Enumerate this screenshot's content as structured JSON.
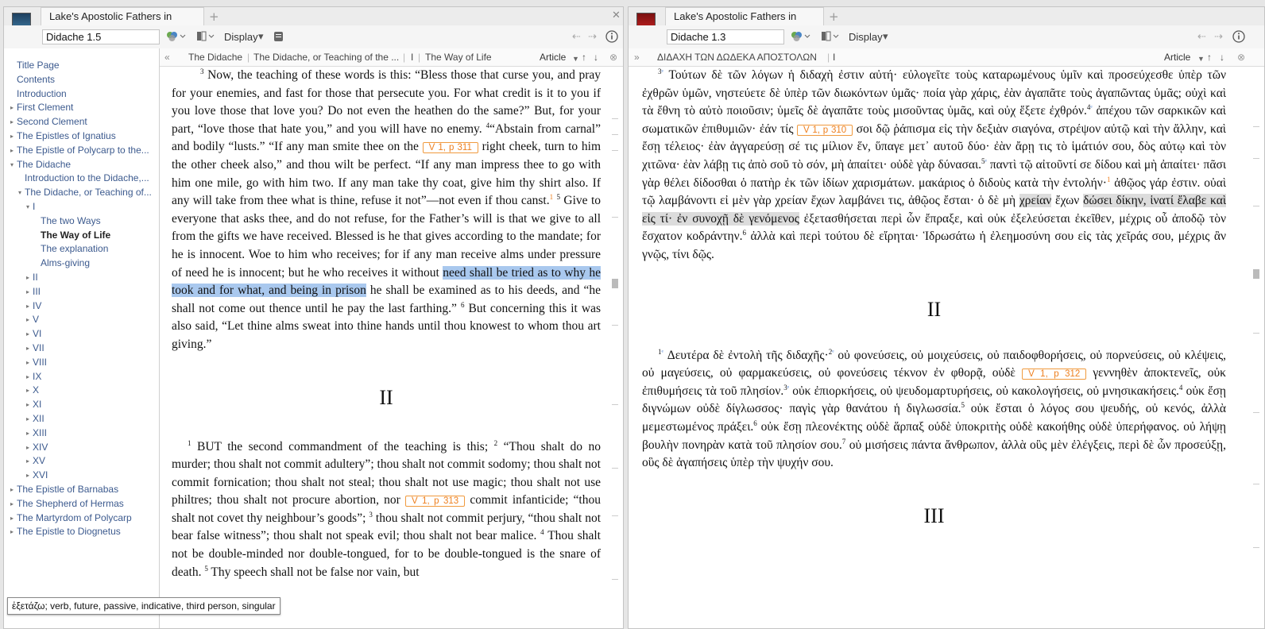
{
  "left_pane": {
    "tab_title": "Lake's Apostolic Fathers in English",
    "book_badge": "A",
    "reference": "Didache 1.5",
    "display_label": "Display",
    "breadcrumb": [
      "The Didache",
      "The Didache, or Teaching of the ...",
      "I",
      "The Way of Life"
    ],
    "view_label": "Article",
    "toc": [
      {
        "label": "Title Page",
        "level": 0,
        "toggle": ""
      },
      {
        "label": "Contents",
        "level": 0,
        "toggle": ""
      },
      {
        "label": "Introduction",
        "level": 0,
        "toggle": ""
      },
      {
        "label": "First Clement",
        "level": 0,
        "toggle": "▸"
      },
      {
        "label": "Second Clement",
        "level": 0,
        "toggle": "▸"
      },
      {
        "label": "The Epistles of Ignatius",
        "level": 0,
        "toggle": "▸"
      },
      {
        "label": "The Epistle of Polycarp to the...",
        "level": 0,
        "toggle": "▸"
      },
      {
        "label": "The Didache",
        "level": 0,
        "toggle": "▾"
      },
      {
        "label": "Introduction to the Didache,...",
        "level": 1,
        "toggle": ""
      },
      {
        "label": "The Didache, or Teaching of...",
        "level": 1,
        "toggle": "▾"
      },
      {
        "label": "I",
        "level": 2,
        "toggle": "▾"
      },
      {
        "label": "The two Ways",
        "level": 3,
        "toggle": ""
      },
      {
        "label": "The Way of Life",
        "level": 3,
        "toggle": "",
        "selected": true
      },
      {
        "label": "The explanation",
        "level": 3,
        "toggle": ""
      },
      {
        "label": "Alms-giving",
        "level": 3,
        "toggle": ""
      },
      {
        "label": "II",
        "level": 2,
        "toggle": "▸"
      },
      {
        "label": "III",
        "level": 2,
        "toggle": "▸"
      },
      {
        "label": "IV",
        "level": 2,
        "toggle": "▸"
      },
      {
        "label": "V",
        "level": 2,
        "toggle": "▸"
      },
      {
        "label": "VI",
        "level": 2,
        "toggle": "▸"
      },
      {
        "label": "VII",
        "level": 2,
        "toggle": "▸"
      },
      {
        "label": "VIII",
        "level": 2,
        "toggle": "▸"
      },
      {
        "label": "IX",
        "level": 2,
        "toggle": "▸"
      },
      {
        "label": "X",
        "level": 2,
        "toggle": "▸"
      },
      {
        "label": "XI",
        "level": 2,
        "toggle": "▸"
      },
      {
        "label": "XII",
        "level": 2,
        "toggle": "▸"
      },
      {
        "label": "XIII",
        "level": 2,
        "toggle": "▸"
      },
      {
        "label": "XIV",
        "level": 2,
        "toggle": "▸"
      },
      {
        "label": "XV",
        "level": 2,
        "toggle": "▸"
      },
      {
        "label": "XVI",
        "level": 2,
        "toggle": "▸"
      },
      {
        "label": "The Epistle of Barnabas",
        "level": 0,
        "toggle": "▸"
      },
      {
        "label": "The Shepherd of Hermas",
        "level": 0,
        "toggle": "▸"
      },
      {
        "label": "The Martyrdom of Polycarp",
        "level": 0,
        "toggle": "▸"
      },
      {
        "label": "The Epistle to Diognetus",
        "level": 0,
        "toggle": "▸"
      }
    ],
    "text": {
      "v3_num": "3",
      "p1_a": " Now, the teaching of these words is this: “Bless those that curse you, and pray for your enemies, and fast for those that persecute you. For what credit is it to you if you love those that love you? Do not even the heathen do the same?” But, for your part, “love those that hate you,” and you will have no enemy. ",
      "v4_num": "4",
      "p1_b": "“Abstain from carnal” and bodily “lusts.” “If any man smite thee on the ",
      "page_311": "V 1, p 311",
      "p1_c": " right cheek, turn to him the other cheek also,” and thou wilt be perfect. “If any man impress thee to go with him one mile, go with him two. If any man take thy coat, give him thy shirt also. If any will take from thee what is thine, refuse it not”—not even if thou canst.",
      "fn1": "1",
      "v5_num": "5",
      "p1_d": " Give to everyone that asks thee, and do not refuse, for the Father’s will is that we give to all from the gifts we have received. Blessed is he that gives according to the mandate; for he is innocent. Woe to him who receives; for if any man receive alms under pressure of need he is innocent; but he who receives it without ",
      "p1_highlight": "need shall be tried as to why he took and for what, and being in prison",
      "p1_e": " he shall be examined as to his deeds, and “he shall not come out thence until he pay the last farthing.” ",
      "v6_num": "6",
      "p1_f": " But concerning this it was also said, “Let thine alms sweat into thine hands until thou knowest to whom thou art giving.”",
      "section_ii": "II",
      "v1_num": "1",
      "p2_a": " BUT the second commandment of the teaching is this; ",
      "v2_num": "2",
      "p2_b": " “Thou shalt do no murder; thou shalt not commit adultery”; thou shalt not commit sodomy; thou shalt not commit fornication; thou shalt not steal; thou shalt not use magic; thou shalt not use philtres; thou shalt not procure abortion, nor ",
      "page_313": "V 1, p 313",
      "p2_c": " commit infanticide; “thou shalt not covet thy neighbour’s goods”; ",
      "v3b_num": "3",
      "p2_d": " thou shalt not commit perjury, “thou shalt not bear false witness”; thou shalt not speak evil; thou shalt not bear malice. ",
      "v4b_num": "4",
      "p2_e": " Thou shalt not be double-minded nor double-tongued, for to be double-tongued is the snare of death. ",
      "v5b_num": "5",
      "p2_f": " Thy speech shall not be false nor vain, but"
    }
  },
  "right_pane": {
    "tab_title": "Lake's Apostolic Fathers in Greek",
    "book_badge": "A",
    "reference": "Didache 1.3",
    "display_label": "Display",
    "breadcrumb": [
      "ΔΙΔΑΧΗ ΤΩΝ ΔΩΔΕΚΑ ΑΠΟΣΤΟΛΩΝ",
      "I"
    ],
    "view_label": "Article",
    "text": {
      "v3_num": "3",
      "g1_a": " Τούτων δὲ τῶν λόγων ἡ διδαχὴ ἐστιν αὐτή· εὐλογεῖτε τοὺς καταρωμένους ὑμῖν καὶ προσεύχεσθε ὑπὲρ τῶν ἐχθρῶν ὑμῶν, νηστεύετε δὲ ὑπὲρ τῶν διωκόντων ὑμᾶς· ποία γὰρ χάρις, ἐὰν ἀγαπᾶτε τοὺς ἀγαπῶντας ὑμᾶς; οὐχὶ καὶ τὰ ἔθνη τὸ αὐτὸ ποιοῦσιν; ὑμεῖς δὲ ἀγαπᾶτε τοὺς μισοῦντας ὑμᾶς, καὶ οὐχ ἕξετε ἐχθρόν.",
      "v4_num": "4",
      "g1_b": " ἀπέχου τῶν σαρκικῶν καὶ σωματικῶν ἐπιθυμιῶν· ἐάν τίς ",
      "page_310": "V 1, p 310",
      "g1_c": " σοι δῷ ῥάπισμα εἰς τὴν δεξιὰν σιαγόνα, στρέψον αὐτῷ καὶ τὴν ἄλλην, καὶ ἔσῃ τέλειος· ἐὰν ἀγγαρεύσῃ σέ τις μίλιον ἕν, ὕπαγε μετ᾽ αυτοῦ δύο· ἐὰν ἄρῃ τις τὸ ἱμάτιόν σου, δὸς αὐτῳ καὶ τὸν χιτῶνα· ἐὰν λάβῃ τις ἀπὸ σοῦ τὸ σόν, μὴ ἀπαίτει· οὐδὲ γὰρ δύνασαι.",
      "v5_num": "5",
      "g1_d": " παντὶ τῷ αἰτοῦντί σε δίδου καὶ μὴ ἀπαίτει· πᾶσι γὰρ θέλει δίδοσθαι ὁ πατὴρ ἐκ τῶν ἰδίων χαρισμάτων. μακάριος ὁ διδοὺς κατὰ τὴν ἐντολήν·",
      "fn1": "1",
      "g1_e": " ἀθῷος γάρ ἐστιν. οὐαὶ τῷ λαμβάνοντι εἰ μὲν γὰρ χρείαν ἔχων λαμβάνει τις, ἀθῷος ἔσται· ὁ δὲ μὴ ",
      "g1_gray1": "χρείαν",
      "g1_f": " ἔχων ",
      "g1_gray2": "δώσει δίκην, ἱνατί ἔλαβε καὶ εἰς τί· ἐν συνοχῇ δὲ γενόμενος",
      "g1_g": " ἐξετασθήσεται περὶ ὧν ἔπραξε, καὶ οὐκ ἐξελεύσεται ἐκεῖθεν, μέχρις οὗ ἀποδῷ τὸν ἔσχατον κοδράντην.",
      "v6_num": "6",
      "g1_h": " ἀλλὰ καὶ περὶ τούτου δὲ εἴρηται· Ἱδρωσάτω ἡ ἐλεημοσύνη σου εἰς τὰς χεῖράς σου, μέχρις ἂν γνῷς, τίνι δῷς.",
      "section_ii": "II",
      "v1_num": "1",
      "g2_a": " Δευτέρα δὲ ἐντολὴ τῆς διδαχῆς·",
      "v2_num": "2",
      "g2_b": " οὐ φονεύσεις, οὐ μοιχεύσεις, οὐ παιδοφθορήσεις, οὐ πορνεύσεις, οὐ κλέψεις, οὐ μαγεύσεις, οὐ φαρμακεύσεις, οὐ φονεύσεις τέκνον ἐν φθορᾷ, οὐδὲ ",
      "page_312": "V 1, p 312",
      "g2_c": " γεννηθὲν ἀποκτενεῖς, οὐκ ἐπιθυμήσεις τὰ τοῦ πλησίον.",
      "v3b_num": "3",
      "g2_d": " οὐκ ἐπιορκήσεις, οὐ ψευδομαρτυρήσεις, οὐ κακολογήσεις, οὐ μνησικακήσεις.",
      "v4b_num": "4",
      "g2_e": " οὐκ ἔσῃ διγνώμων οὐδὲ δίγλωσσος· παγὶς γὰρ θανάτου ἡ διγλωσσία.",
      "v5b_num": "5",
      "g2_f": " οὐκ ἔσται ὁ λόγος σου ψευδής, οὐ κενός, ἀλλὰ μεμεστωμένος πράξει.",
      "v6b_num": "6",
      "g2_g": " οὐκ ἔσῃ πλεονέκτης οὐδὲ ἅρπαξ οὐδὲ ὑποκριτὴς οὐδὲ κακοήθης οὐδὲ ὑπερήφανος. οὐ λήψῃ βουλὴν πονηρὰν κατὰ τοῦ πλησίον σου.",
      "v7_num": "7",
      "g2_h": " οὐ μισήσεις πάντα ἄνθρωπον, ἀλλὰ οὓς μὲν ἐλέγξεις, περὶ δὲ ὧν προσεύξῃ, οὓς δὲ ἀγαπήσεις ὑπὲρ τὴν ψυχήν σου.",
      "section_iii": "III"
    }
  },
  "tooltip": "ἐξετάζω; verb, future, passive, indicative, third person, singular",
  "icons": {
    "tab_add": "plus-icon",
    "tab_close": "close-icon",
    "back": "arrow-left-icon",
    "forward": "arrow-right-icon",
    "info": "info-icon",
    "parallel": "parallel-resources-icon",
    "panel": "panel-icon",
    "collapse": "double-chevron-icon"
  },
  "colors": {
    "accent_orange": "#ee7f1e",
    "toc_link": "#3c5a8e",
    "selection": "#a9c8ee"
  }
}
